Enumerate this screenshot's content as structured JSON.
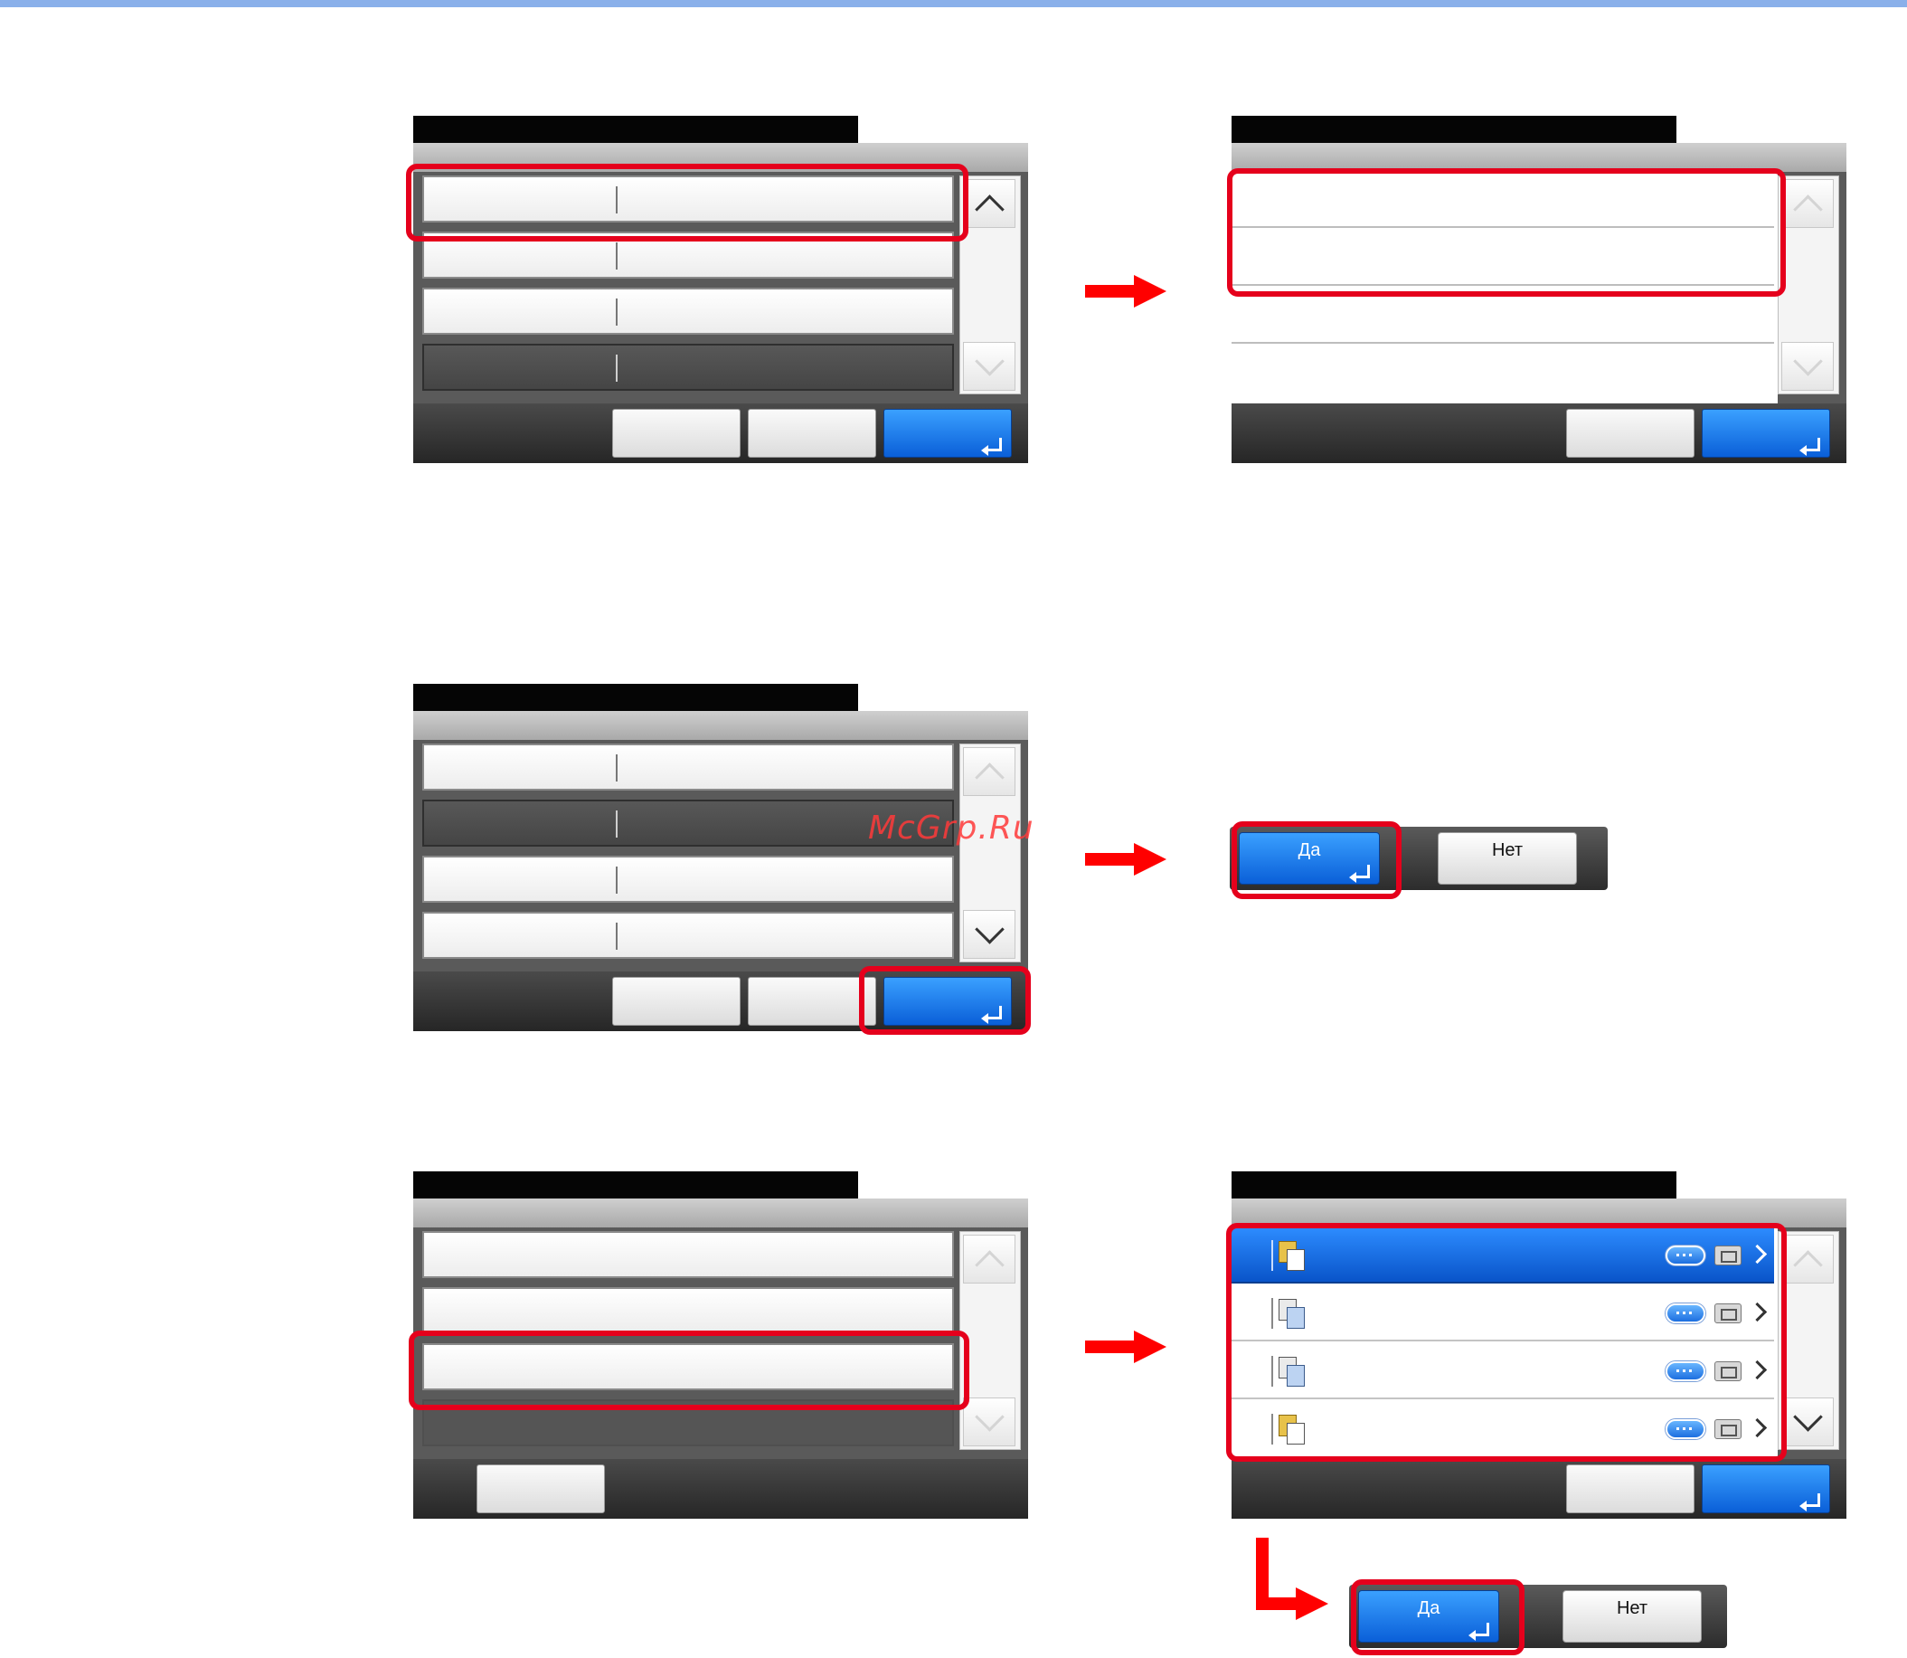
{
  "watermark": "McGrp.Ru",
  "confirm_dialog_1": {
    "yes_label": "Да",
    "no_label": "Нет"
  },
  "confirm_dialog_2": {
    "yes_label": "Да",
    "no_label": "Нет"
  },
  "colors": {
    "highlight": "#e5001c",
    "arrow": "#ff0000",
    "accent_blue": "#1a73e8"
  },
  "panel_6_rows": [
    {
      "icon": "folder-document-icon",
      "selected": true
    },
    {
      "icon": "copy-document-icon",
      "selected": false
    },
    {
      "icon": "copy-document-icon",
      "selected": false
    },
    {
      "icon": "folder-document-icon",
      "selected": false
    }
  ]
}
